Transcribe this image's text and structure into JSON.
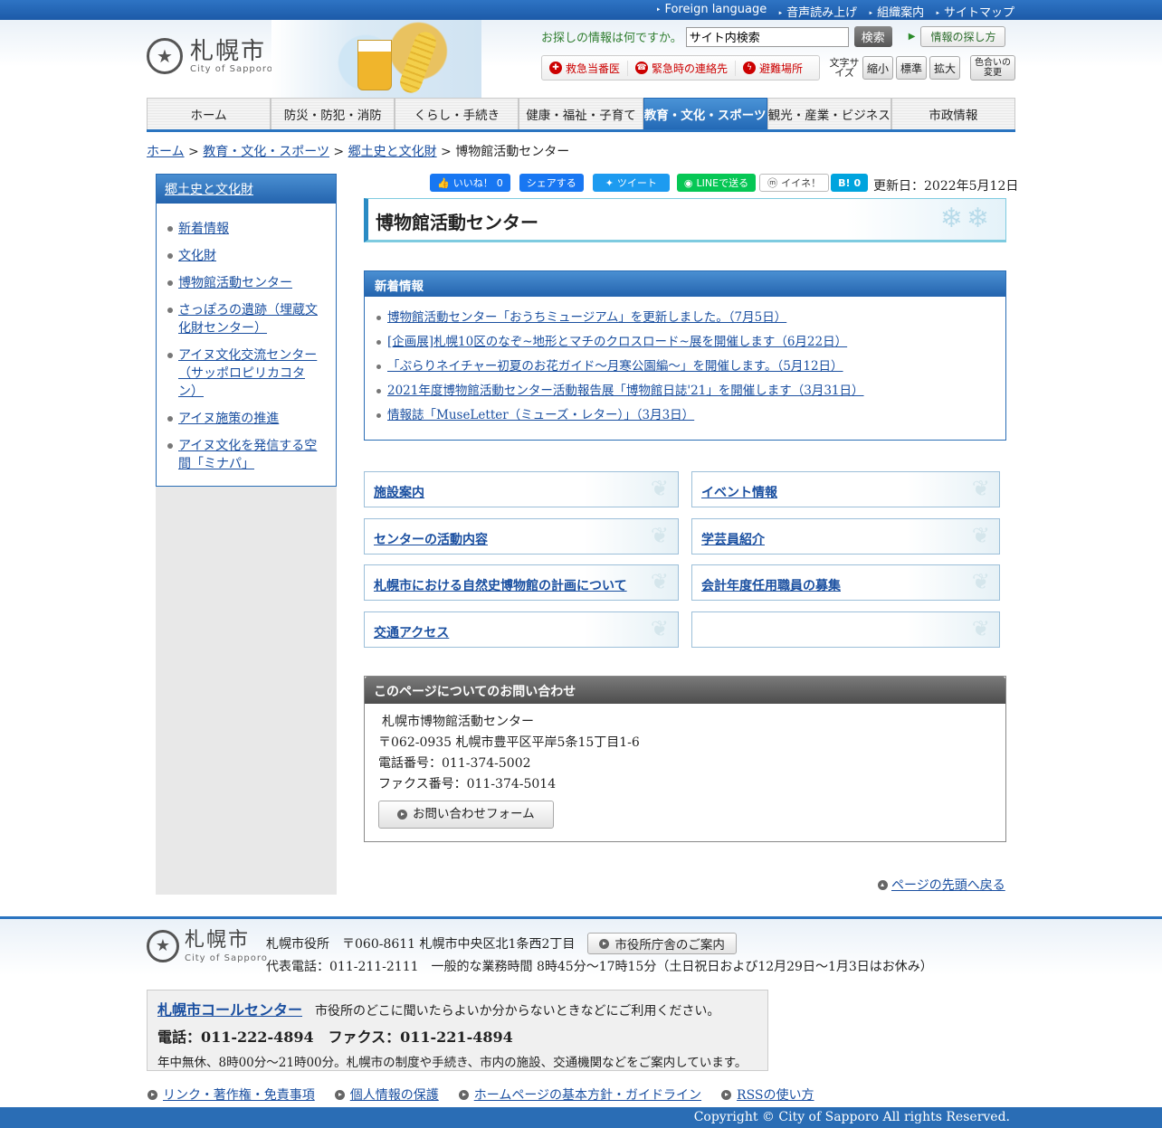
{
  "topbar": {
    "links": [
      "Foreign language",
      "音声読み上げ",
      "組織案内",
      "サイトマップ"
    ]
  },
  "logo": {
    "jp": "札幌市",
    "en": "City of Sapporo"
  },
  "search": {
    "question": "お探しの情報は何ですか。",
    "value": "サイト内検索",
    "button": "検索",
    "howto": "情報の探し方"
  },
  "emergency": [
    "救急当番医",
    "緊急時の連絡先",
    "避難場所"
  ],
  "fontsize": {
    "label": "文字サイズ",
    "small": "縮小",
    "normal": "標準",
    "large": "拡大"
  },
  "color_change": "色合いの変更",
  "gnav": [
    "ホーム",
    "防災・防犯・消防",
    "くらし・手続き",
    "健康・福祉・子育て",
    "教育・文化・スポーツ",
    "観光・産業・ビジネス",
    "市政情報"
  ],
  "gnav_active": 4,
  "breadcrumb": {
    "items": [
      "ホーム",
      "教育・文化・スポーツ",
      "郷土史と文化財"
    ],
    "sep": " > ",
    "current": "博物館活動センター"
  },
  "sidebar": {
    "title": "郷土史と文化財",
    "items": [
      "新着情報",
      "文化財",
      "博物館活動センター",
      "さっぽろの遺跡（埋蔵文化財センター）",
      "アイヌ文化交流センター（サッポロピリカコタン）",
      "アイヌ施策の推進",
      "アイヌ文化を発信する空間「ミナパ」"
    ]
  },
  "social": {
    "like": "いいね！",
    "like_count": "0",
    "share": "シェアする",
    "tweet": "ツイート",
    "line": "LINEで送る",
    "mixi": "イイネ！",
    "hatena": "B!",
    "hatena_count": "0"
  },
  "updated": "更新日：2022年5月12日",
  "title": "博物館活動センター",
  "news": {
    "heading": "新着情報",
    "items": [
      "博物館活動センター「おうちミュージアム」を更新しました。（7月5日）",
      "[企画展]札幌10区のなぞ~地形とマチのクロスロード~展を開催します（6月22日）",
      "「ぷらりネイチャー初夏のお花ガイド～月寒公園編～」を開催します。（5月12日）",
      "2021年度博物館活動センター活動報告展「博物館日誌'21」を開催します（3月31日）",
      "情報誌「MuseLetter（ミューズ・レター）」（3月3日）"
    ]
  },
  "cards": [
    "施設案内",
    "イベント情報",
    "センターの活動内容",
    "学芸員紹介",
    "札幌市における自然史博物館の計画について",
    "会計年度任用職員の募集",
    "交通アクセス",
    ""
  ],
  "contact": {
    "heading": "このページについてのお問い合わせ",
    "name": "札幌市博物館活動センター",
    "address": "〒062-0935 札幌市豊平区平岸5条15丁目1-6",
    "phone": "電話番号：011-374-5002",
    "fax": "ファクス番号：011-374-5014",
    "form_button": "お問い合わせフォーム"
  },
  "totop": "ページの先頭へ戻る",
  "footer": {
    "address": "札幌市役所　〒060-8611 札幌市中央区北1条西2丁目",
    "office_button": "市役所庁舎のご案内",
    "phone": "代表電話：011-211-2111　一般的な業務時間 8時45分～17時15分（土日祝日および12月29日～1月3日はお休み）",
    "callcenter": {
      "title": "札幌市コールセンター",
      "desc": "市役所のどこに聞いたらよいか分からないときなどにご利用ください。",
      "contact": "電話：011-222-4894　ファクス：011-221-4894",
      "hours": "年中無休、8時00分～21時00分。札幌市の制度や手続き、市内の施設、交通機関などをご案内しています。"
    },
    "links": [
      "リンク・著作権・免責事項",
      "個人情報の保護",
      "ホームページの基本方針・ガイドライン",
      "RSSの使い方"
    ],
    "copyright": "Copyright © City of Sapporo All rights Reserved."
  }
}
